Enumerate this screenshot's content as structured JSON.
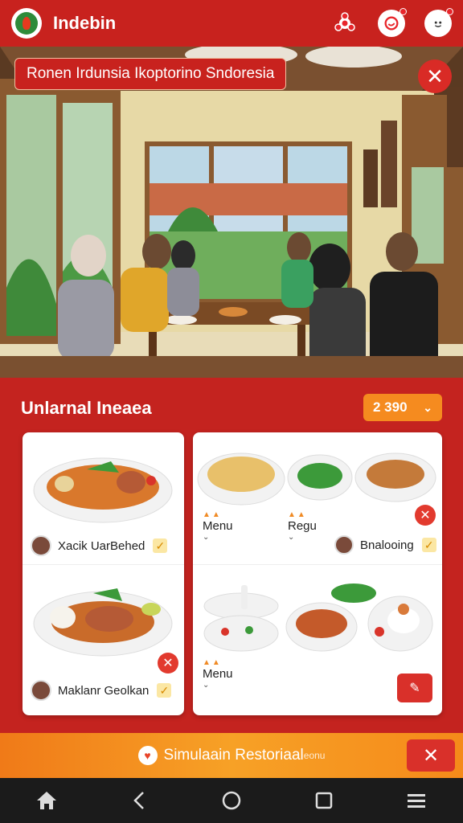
{
  "app": {
    "title": "Indebin"
  },
  "topbar": {
    "icons": [
      "share-icon",
      "chat-icon",
      "profile-icon"
    ]
  },
  "hero": {
    "label": "Ronen Irdunsia Ikoptorino Sndoresia",
    "close_symbol": "✕"
  },
  "section": {
    "title": "Unlarnal Ineaea",
    "price": "2 390",
    "price_chevron": "⌄"
  },
  "dishes_left": [
    {
      "name": "Xacik UarBehed",
      "check": "✓"
    },
    {
      "name": "Maklanr Geolkan",
      "check": "✓"
    }
  ],
  "dishes_right": {
    "labels": [
      "Menu",
      "Regu"
    ],
    "featured": {
      "name": "Bnalooing",
      "check": "✓"
    },
    "bottom_label": "Menu",
    "edit_symbol": "✎"
  },
  "banner": {
    "text": "Simulaain  Restoriaal",
    "suffix": "eonu",
    "close_symbol": "✕"
  },
  "navbar": {
    "icons": [
      "home-icon",
      "back-icon",
      "circle-home-icon",
      "recents-icon",
      "menu-icon"
    ]
  },
  "colors": {
    "primary": "#c8221e",
    "accent": "#f58b1f",
    "nav": "#1b1b1b"
  }
}
